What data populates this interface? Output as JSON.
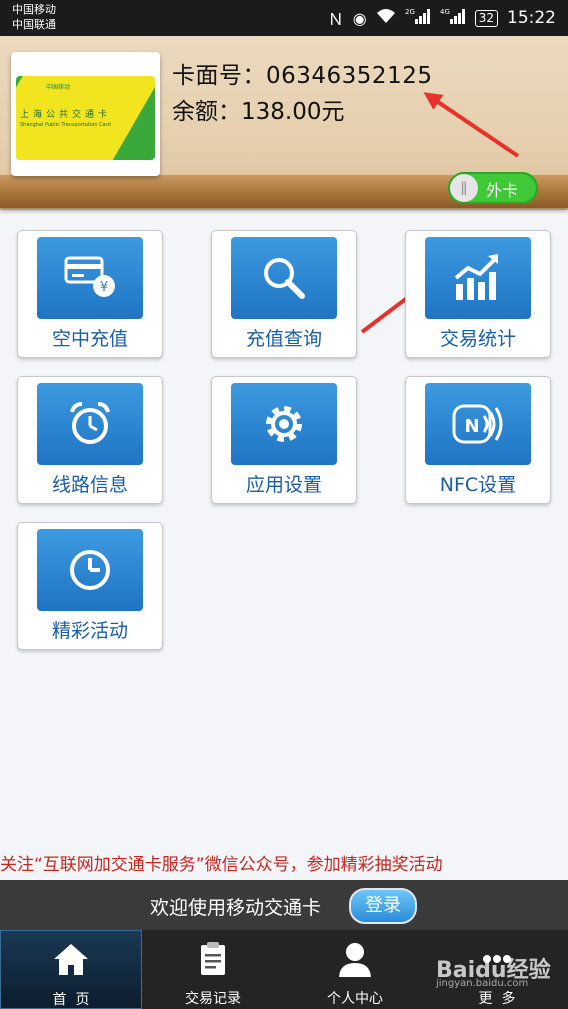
{
  "status_bar": {
    "carrier_1": "中国移动",
    "carrier_2": "中国联通",
    "signal_1": "2G",
    "signal_2": "4G",
    "battery": "32",
    "time": "15:22",
    "icons": [
      "nfc-icon",
      "eye-icon",
      "wifi-icon",
      "signal-icon",
      "signal-icon",
      "battery-icon"
    ]
  },
  "card": {
    "image_title": "上海公共交通卡",
    "image_subtitle": "Shanghai Public Transportation Card",
    "image_logo": "中国移动",
    "number_label": "卡面号：",
    "number_value": "06346352125",
    "balance_label": "余额：",
    "balance_value": "138.00元"
  },
  "card_toggle": {
    "label": "外卡",
    "state": "on"
  },
  "menu": [
    {
      "label": "空中充值",
      "icon": "card-recharge-icon"
    },
    {
      "label": "充值查询",
      "icon": "search-icon"
    },
    {
      "label": "交易统计",
      "icon": "chart-icon"
    },
    {
      "label": "线路信息",
      "icon": "alarm-clock-icon"
    },
    {
      "label": "应用设置",
      "icon": "gear-icon"
    },
    {
      "label": "NFC设置",
      "icon": "nfc-icon"
    },
    {
      "label": "精彩活动",
      "icon": "clock-icon"
    }
  ],
  "marquee": "关注“互联网加交通卡服务”微信公众号，参加精彩抽奖活动",
  "welcome": {
    "text": "欢迎使用移动交通卡",
    "login_label": "登录"
  },
  "tabs": [
    {
      "label": "首  页",
      "icon": "home-icon",
      "active": true
    },
    {
      "label": "交易记录",
      "icon": "clipboard-icon",
      "active": false
    },
    {
      "label": "个人中心",
      "icon": "user-icon",
      "active": false
    },
    {
      "label": "更  多",
      "icon": "more-icon",
      "active": false
    }
  ],
  "watermark": {
    "brand": "Baidu经验",
    "url": "jingyan.baidu.com"
  },
  "colors": {
    "accent": "#2b8bd8",
    "toggle_on": "#3fc936",
    "annotation": "#e8312a",
    "marquee": "#c5271f"
  }
}
